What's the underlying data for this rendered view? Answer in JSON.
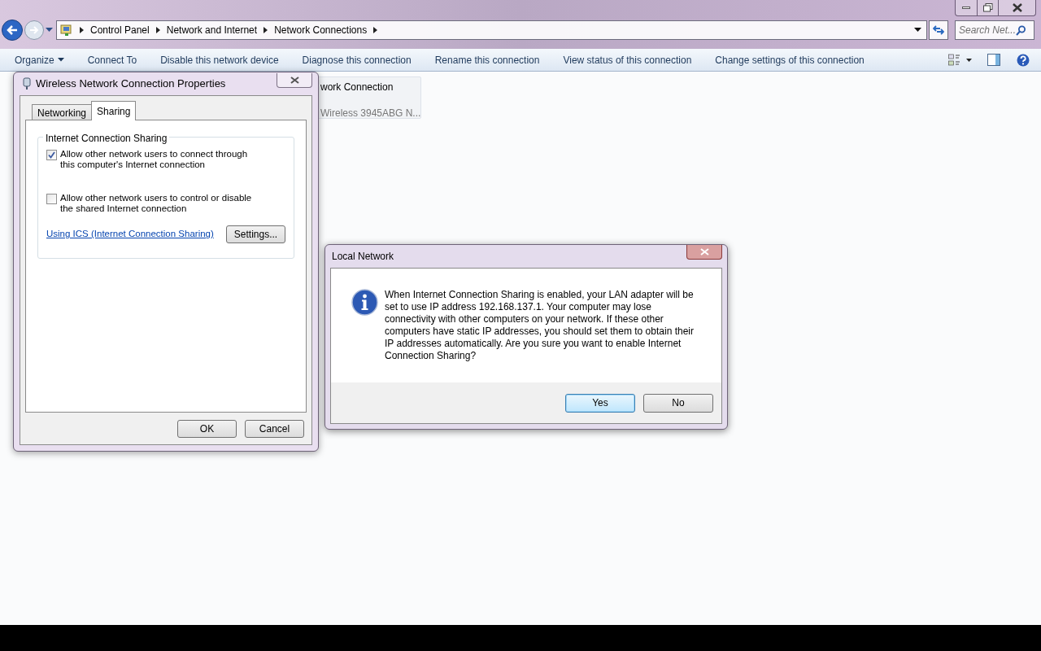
{
  "nav": {
    "breadcrumbs": [
      "Control Panel",
      "Network and Internet",
      "Network Connections"
    ],
    "search": {
      "placeholder": "Search Net..."
    }
  },
  "toolbar": {
    "items": [
      {
        "label": "Organize",
        "kind": "menu"
      },
      {
        "label": "Connect To",
        "kind": "command"
      },
      {
        "label": "Disable this network device",
        "kind": "command"
      },
      {
        "label": "Diagnose this connection",
        "kind": "command"
      },
      {
        "label": "Rename this connection",
        "kind": "command"
      },
      {
        "label": "View status of this connection",
        "kind": "command"
      },
      {
        "label": "Change settings of this connection",
        "kind": "command"
      }
    ]
  },
  "connection_item": {
    "name": "work Connection",
    "device": "Wireless 3945ABG N..."
  },
  "properties_dialog": {
    "title": "Wireless Network Connection Properties",
    "tabs": [
      {
        "label": "Networking",
        "selected": false
      },
      {
        "label": "Sharing",
        "selected": true
      }
    ],
    "group_title": "Internet Connection Sharing",
    "options": [
      {
        "label": "Allow other network users to connect through this computer's Internet connection",
        "checked": true
      },
      {
        "label": "Allow other network users to control or disable the shared Internet connection",
        "checked": false
      }
    ],
    "link": "Using ICS (Internet Connection Sharing)",
    "settings_button": "Settings...",
    "buttons": [
      "OK",
      "Cancel"
    ]
  },
  "message_box": {
    "title": "Local Network",
    "message": "When Internet Connection Sharing is enabled, your LAN adapter will be set to use IP address 192.168.137.1. Your computer may lose connectivity with other computers on your network. If these other computers have static IP addresses, you should set them to obtain their IP addresses automatically.  Are you sure you want to enable Internet Connection Sharing?",
    "buttons": [
      {
        "label": "Yes",
        "selected": true
      },
      {
        "label": "No",
        "selected": false
      }
    ]
  }
}
